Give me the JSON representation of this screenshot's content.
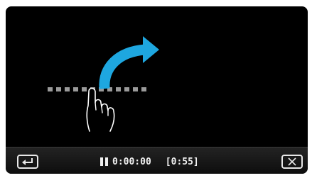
{
  "playback": {
    "state_icon": "pause-icon",
    "elapsed_time": "0:00:00",
    "remaining_time": "[0:55]"
  },
  "gesture_hint": {
    "gesture": "swipe-right",
    "icons": [
      "hand-pointer-icon",
      "curved-arrow-right-icon"
    ],
    "arrow_color": "#1ea7e0",
    "slider_color": "#9a9a9a"
  },
  "controls": {
    "back_icon": "return-arrow-icon",
    "close_icon": "close-icon"
  }
}
